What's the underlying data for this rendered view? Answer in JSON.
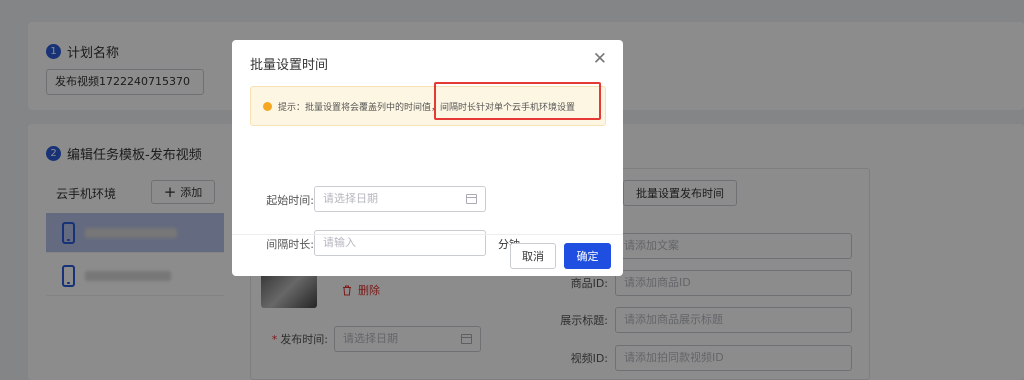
{
  "background": {
    "step1": {
      "num": "1",
      "title": "计划名称"
    },
    "plan_name_value": "发布视频1722240715370",
    "step2": {
      "num": "2",
      "title": "编辑任务模板-发布视频"
    },
    "env_label": "云手机环境",
    "add_button": {
      "icon": "plus-icon",
      "label": "添加"
    },
    "batch_set_publish_time_label": "批量设置发布时间",
    "delete_label": "删除",
    "publish_time": {
      "label": "发布时间:",
      "placeholder": "请选择日期"
    },
    "caption_placeholder": "请添加文案",
    "product_id": {
      "label": "商品ID:",
      "placeholder": "请添加商品ID"
    },
    "display_title": {
      "label": "展示标题:",
      "placeholder": "请添加商品展示标题"
    },
    "video_id": {
      "label": "视频ID:",
      "placeholder": "请添加拍同款视频ID"
    }
  },
  "modal": {
    "title": "批量设置时间",
    "close_icon": "close-icon",
    "tip_text": "提示：批量设置将会覆盖列中的时间值，间隔时长针对单个云手机环境设置",
    "start_time": {
      "label": "起始时间:",
      "placeholder": "请选择日期"
    },
    "interval": {
      "label": "间隔时长:",
      "placeholder": "请输入",
      "unit": "分钟"
    },
    "cancel_label": "取消",
    "ok_label": "确定"
  },
  "colors": {
    "primary": "#1f4fe0",
    "warning": "#f5a623",
    "danger": "#e53935"
  }
}
